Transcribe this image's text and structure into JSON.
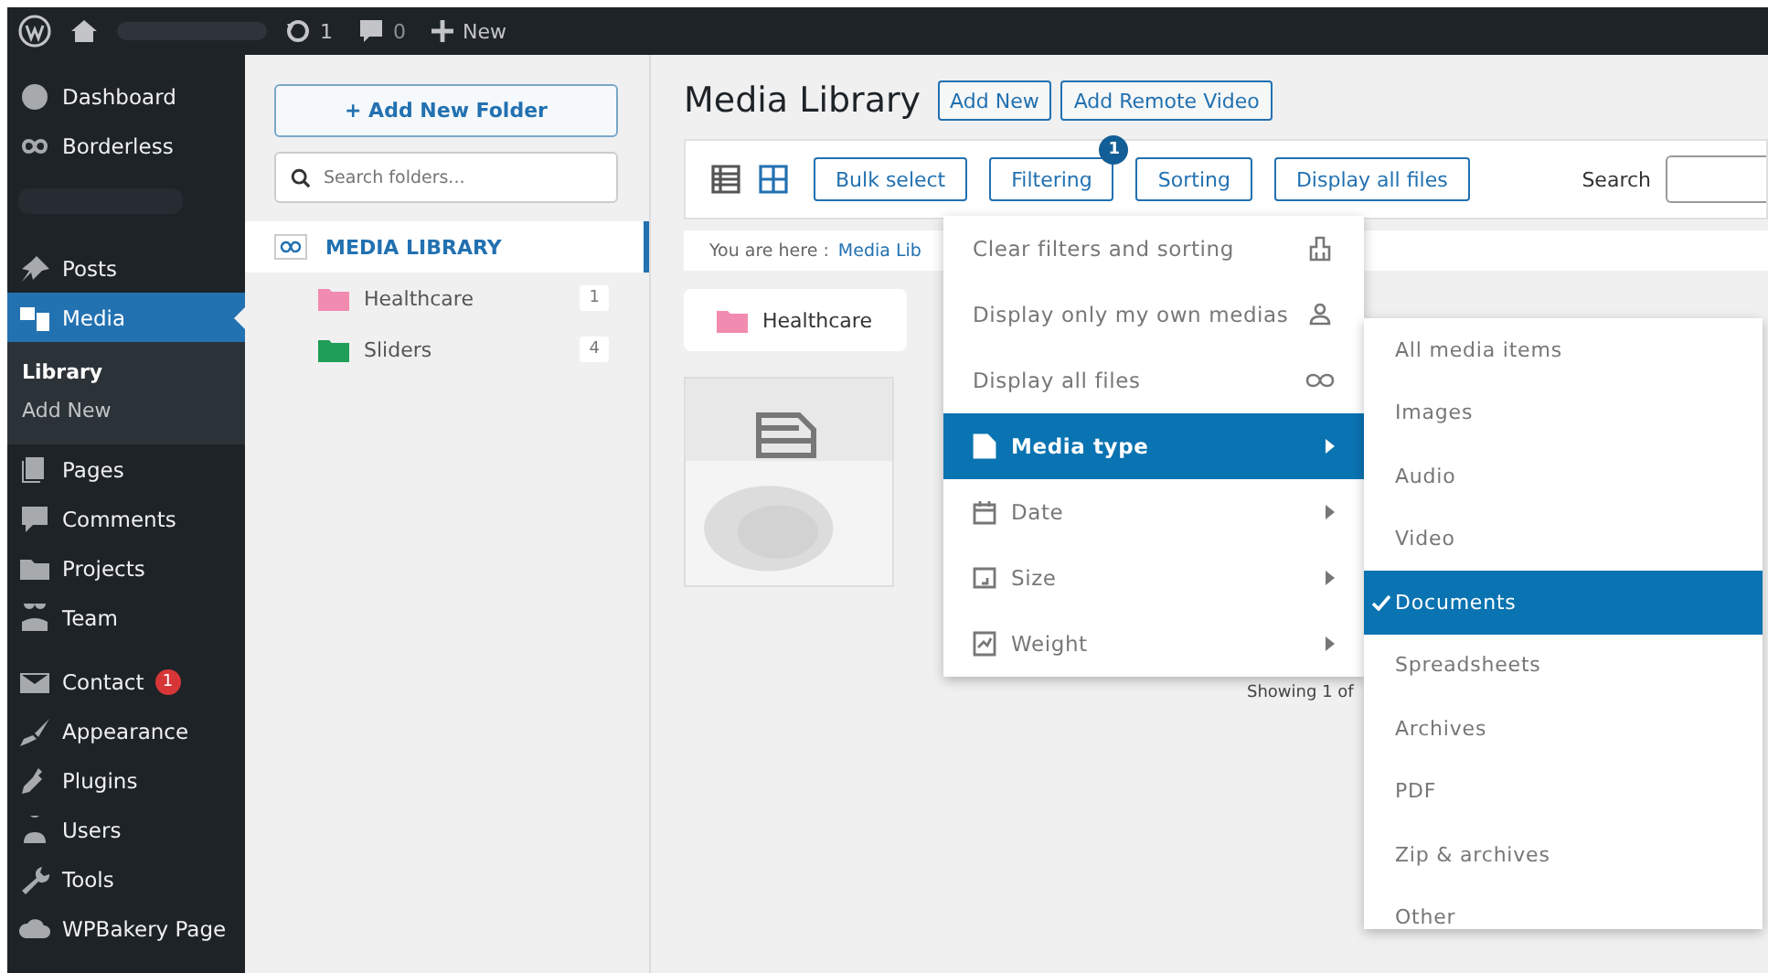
{
  "admin_bar": {
    "updates": "1",
    "comments": "0",
    "new": "New"
  },
  "sidebar": {
    "items": [
      {
        "label": "Dashboard",
        "selected": false
      },
      {
        "label": "Borderless",
        "selected": false
      },
      {
        "label": "Posts",
        "selected": false
      },
      {
        "label": "Media",
        "selected": true,
        "children": [
          {
            "label": "Library",
            "selected": true
          },
          {
            "label": "Add New",
            "selected": false
          }
        ]
      },
      {
        "label": "Pages",
        "selected": false
      },
      {
        "label": "Comments",
        "selected": false
      },
      {
        "label": "Projects",
        "selected": false
      },
      {
        "label": "Team",
        "selected": false
      },
      {
        "label": "Contact",
        "selected": false,
        "badge": "1"
      },
      {
        "label": "Appearance",
        "selected": false
      },
      {
        "label": "Plugins",
        "selected": false
      },
      {
        "label": "Users",
        "selected": false
      },
      {
        "label": "Tools",
        "selected": false
      },
      {
        "label": "WPBakery Page",
        "selected": false
      }
    ]
  },
  "folders": {
    "add_button": "+ Add New Folder",
    "search": {
      "placeholder": "Search folders..."
    },
    "root": {
      "label": "MEDIA LIBRARY",
      "selected": true,
      "children": [
        {
          "label": "Healthcare",
          "color": "#f28bb0",
          "count": "1"
        },
        {
          "label": "Sliders",
          "color": "#1e9e57",
          "count": "4"
        }
      ]
    }
  },
  "main": {
    "title": "Media Library",
    "header_buttons": [
      "Add New",
      "Add Remote Video"
    ],
    "view_modes": [
      {
        "selected": false
      },
      {
        "selected": true
      }
    ],
    "toolbar_buttons": [
      {
        "label": "Bulk select"
      },
      {
        "label": "Filtering",
        "badge": "1"
      },
      {
        "label": "Sorting"
      },
      {
        "label": "Display all files"
      }
    ],
    "search_label": "Search",
    "breadcrumb": {
      "prefix": "You are here :",
      "link": "Media Lib"
    },
    "folder_card": {
      "label": "Healthcare",
      "color": "#f28bb0"
    },
    "status": "Showing 1 of"
  },
  "filter_menu": {
    "items": [
      {
        "label": "Clear filters and sorting",
        "kind": "action",
        "selected": false
      },
      {
        "label": "Display only my own medias",
        "kind": "action",
        "selected": false
      },
      {
        "label": "Display all files",
        "kind": "action",
        "selected": false
      },
      {
        "label": "Media type",
        "kind": "submenu",
        "selected": true
      },
      {
        "label": "Date",
        "kind": "submenu",
        "selected": false
      },
      {
        "label": "Size",
        "kind": "submenu",
        "selected": false
      },
      {
        "label": "Weight",
        "kind": "submenu",
        "selected": false
      }
    ]
  },
  "media_type_menu": {
    "items": [
      {
        "label": "All media items",
        "checked": false
      },
      {
        "label": "Images",
        "checked": false
      },
      {
        "label": "Audio",
        "checked": false
      },
      {
        "label": "Video",
        "checked": false
      },
      {
        "label": "Documents",
        "checked": true
      },
      {
        "label": "Spreadsheets",
        "checked": false
      },
      {
        "label": "Archives",
        "checked": false
      },
      {
        "label": "PDF",
        "checked": false
      },
      {
        "label": "Zip & archives",
        "checked": false
      },
      {
        "label": "Other",
        "checked": false
      }
    ]
  }
}
